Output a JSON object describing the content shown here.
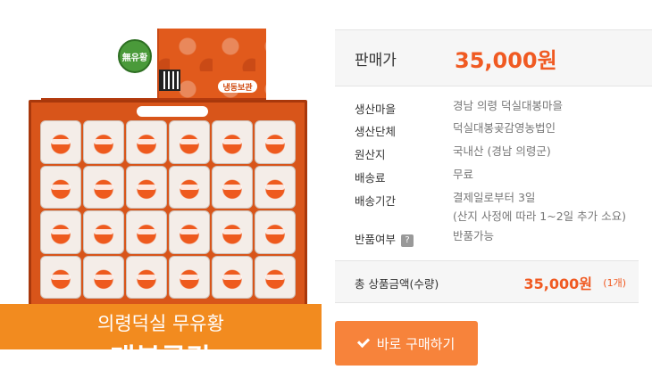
{
  "product": {
    "image_alt": "의령덕실 무유황 대봉곶감",
    "seal_text": "無유황",
    "storage_tag": "냉동보관",
    "caption_line1": "의령덕실 무유황",
    "caption_line2": "대봉곶감"
  },
  "price": {
    "label": "판매가",
    "value": "35,000원"
  },
  "specs": [
    {
      "label": "생산마을",
      "value": "경남 의령 덕실대봉마을"
    },
    {
      "label": "생산단체",
      "value": "덕실대봉곶감영농법인"
    },
    {
      "label": "원산지",
      "value": "국내산 (경남 의령군)"
    },
    {
      "label": "배송료",
      "value": "무료"
    },
    {
      "label": "배송기간",
      "value": "결제일로부터 3일",
      "value2": "(산지 사정에 따라 1~2일 추가 소요)"
    },
    {
      "label": "반품여부",
      "value": "반품가능",
      "help": "?"
    }
  ],
  "total": {
    "label": "총 상품금액(수량)",
    "value": "35,000원",
    "qty": "(1개)"
  },
  "buy_button": {
    "label": "바로 구매하기",
    "icon": "check-icon"
  },
  "colors": {
    "accent": "#f05a22",
    "caption_bg": "#f28b1f",
    "button_bg": "#f7833b"
  }
}
